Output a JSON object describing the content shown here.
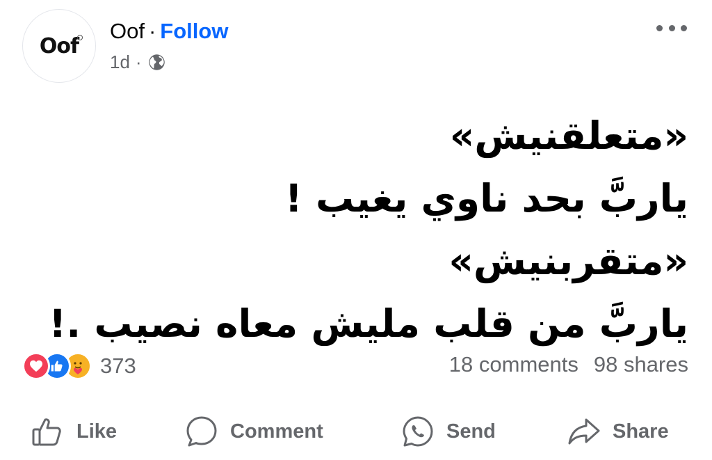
{
  "post": {
    "author": "Oof",
    "avatar_text": "Oof",
    "separator": "·",
    "follow_label": "Follow",
    "time": "1d",
    "meta_separator": "·",
    "privacy_icon": "globe-icon",
    "more_icon": "more-options-icon",
    "lines": [
      "«متعلقنيش»",
      "ياربَّ بحد ناوي يغيب !",
      "«متقربنيش»",
      "ياربَّ من قلب مليش معاه نصيب .!"
    ]
  },
  "engagement": {
    "reactions": [
      "love-reaction-icon",
      "like-reaction-icon",
      "care-reaction-icon"
    ],
    "reaction_count": "373",
    "comments": "18 comments",
    "shares": "98 shares"
  },
  "actions": {
    "like": "Like",
    "comment": "Comment",
    "send": "Send",
    "share": "Share"
  },
  "colors": {
    "accent": "#0866ff",
    "secondary_text": "#65676b",
    "love": "#f33e58",
    "like": "#1877f2",
    "care": "#f7b125"
  }
}
